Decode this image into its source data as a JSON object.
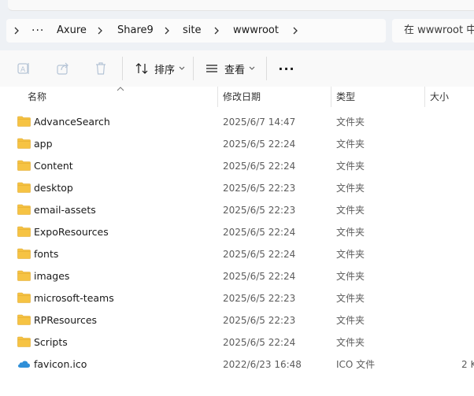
{
  "address_bar": {
    "crumbs": [
      "Axure",
      "Share9",
      "site",
      "wwwroot"
    ],
    "more": "···"
  },
  "search": {
    "placeholder": "在 wwwroot 中"
  },
  "toolbar": {
    "sort_label": "排序",
    "view_label": "查看",
    "more_label": "···"
  },
  "columns": {
    "name": "名称",
    "modified": "修改日期",
    "type": "类型",
    "size": "大小"
  },
  "files": [
    {
      "name": "AdvanceSearch",
      "modified": "2025/6/7 14:47",
      "type": "文件夹",
      "size": "",
      "icon": "folder-icon"
    },
    {
      "name": "app",
      "modified": "2025/6/5 22:24",
      "type": "文件夹",
      "size": "",
      "icon": "folder-icon"
    },
    {
      "name": "Content",
      "modified": "2025/6/5 22:24",
      "type": "文件夹",
      "size": "",
      "icon": "folder-icon"
    },
    {
      "name": "desktop",
      "modified": "2025/6/5 22:23",
      "type": "文件夹",
      "size": "",
      "icon": "folder-icon"
    },
    {
      "name": "email-assets",
      "modified": "2025/6/5 22:23",
      "type": "文件夹",
      "size": "",
      "icon": "folder-icon"
    },
    {
      "name": "ExpoResources",
      "modified": "2025/6/5 22:24",
      "type": "文件夹",
      "size": "",
      "icon": "folder-icon"
    },
    {
      "name": "fonts",
      "modified": "2025/6/5 22:24",
      "type": "文件夹",
      "size": "",
      "icon": "folder-icon"
    },
    {
      "name": "images",
      "modified": "2025/6/5 22:24",
      "type": "文件夹",
      "size": "",
      "icon": "folder-icon"
    },
    {
      "name": "microsoft-teams",
      "modified": "2025/6/5 22:23",
      "type": "文件夹",
      "size": "",
      "icon": "folder-icon"
    },
    {
      "name": "RPResources",
      "modified": "2025/6/5 22:23",
      "type": "文件夹",
      "size": "",
      "icon": "folder-icon"
    },
    {
      "name": "Scripts",
      "modified": "2025/6/5 22:24",
      "type": "文件夹",
      "size": "",
      "icon": "folder-icon"
    },
    {
      "name": "favicon.ico",
      "modified": "2022/6/23 16:48",
      "type": "ICO 文件",
      "size": "2 K",
      "icon": "cloud-icon"
    }
  ],
  "colors": {
    "folder": "#f6c343",
    "folder_dark": "#e0a82e",
    "cloud": "#2f8fd8",
    "chrome_bg": "#eef1f5",
    "toolbar_bg": "#f9f9f9"
  }
}
